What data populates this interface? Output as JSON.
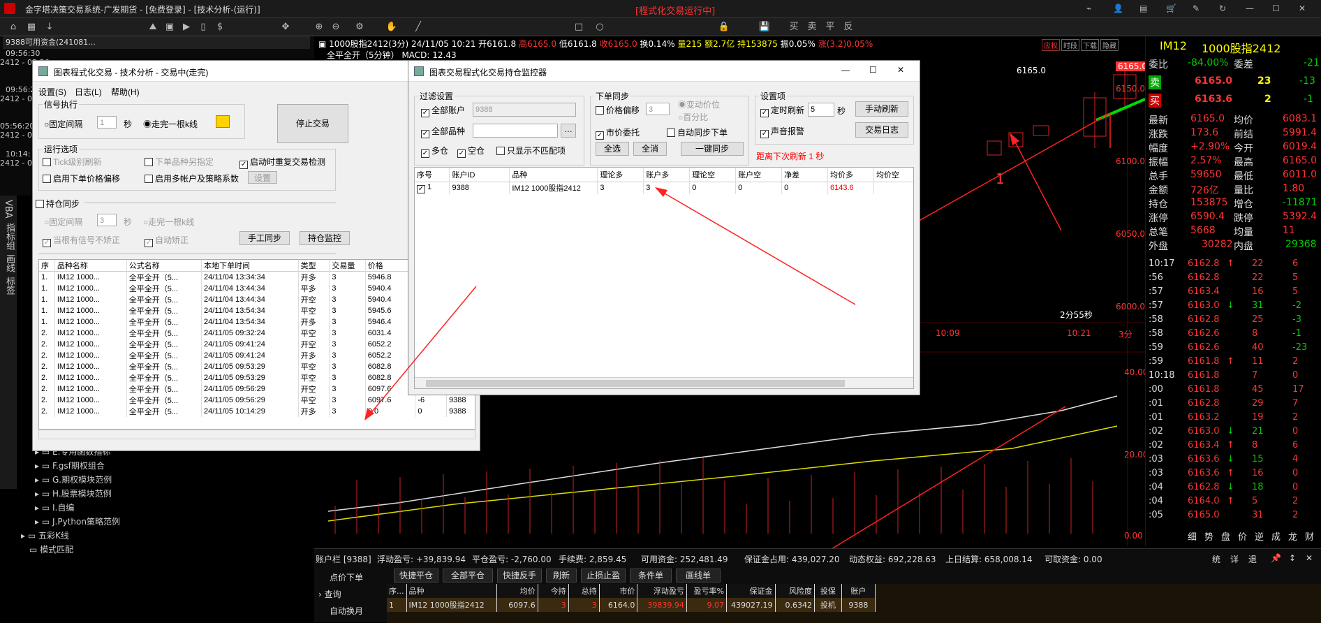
{
  "app": {
    "title": "金字塔决策交易系统-广发期货 - [免费登录] - [技术分析-(运行)]",
    "running": "[程式化交易运行中]"
  },
  "sidebar_top": {
    "line1": "9388可用资金(241081...",
    "times": [
      "09:56:30",
      "2412 - 05:56",
      "09:56:20",
      "2412 - 05:56",
      "05:56:20",
      "2412 - 05:56",
      "10:14:",
      "2412 - 05:"
    ]
  },
  "left_tabs": [
    "VBA",
    "指标组",
    "画线",
    "标签"
  ],
  "tree": {
    "items": [
      "E.专用函数指标",
      "F.gsf期权组合",
      "G.期权模块范例",
      "H.股票模块范例",
      "I.自编",
      "J.Python策略范例"
    ],
    "sub": [
      "五彩K线",
      "模式匹配"
    ]
  },
  "chart_header": {
    "symbol": "1000股指2412(3分) 24/11/05 10:21",
    "open": "开6161.8",
    "high": "高6165.0",
    "low": "低6161.8",
    "close": "收6165.0",
    "chg": "换0.14%",
    "vol": "量215",
    "amt": "额2.7亿",
    "oi": "持153875",
    "amp": "振0.05%",
    "rise": "涨(3.2)0.05%",
    "macd": "全平全开（5分钟） MACD: 12.43",
    "tabs": [
      "应权",
      "时段",
      "下载",
      "隐藏"
    ]
  },
  "chart_labels": {
    "price_tag": "6165.0",
    "yaxis": [
      "6150.0",
      "6100.0",
      "6050.0",
      "6000.0"
    ],
    "hi_lbl": "6165.0",
    "timer": "2分55秒",
    "xaxis": [
      "10:09",
      "10:21",
      "3分"
    ],
    "macd_axis": [
      "40.00",
      "20.00",
      "0.00"
    ],
    "annot1": "1",
    "annot2": "2"
  },
  "exec_window": {
    "title": "图表程式化交易 - 技术分析 - 交易中(走完)",
    "menu": [
      "设置(S)",
      "日志(L)",
      "帮助(H)"
    ],
    "signal": "信号执行",
    "fixed": "固定间隔",
    "fixed_val": "1",
    "sec": "秒",
    "walk": "走完一根k线",
    "stop": "停止交易",
    "run_opts": "运行选项",
    "tick": "Tick级别刷新",
    "next": "下单品种另指定",
    "restart": "启动时重复交易检测",
    "price_off": "启用下单价格偏移",
    "multi": "启用多帐户及策略系数",
    "setup": "设置",
    "sync": "持仓同步",
    "fixed2": "固定间隔",
    "fixed2_val": "3",
    "sec2": "秒",
    "walk2": "走完一根k线",
    "nosig": "当根有信号不矫正",
    "auto": "自动矫正",
    "manual": "手工同步",
    "monitor": "持仓监控",
    "cols": [
      "序",
      "品种名称",
      "公式名称",
      "本地下单时间",
      "类型",
      "交易量",
      "价格",
      "滑点"
    ],
    "rows": [
      [
        "1.",
        "IM12 1000...",
        "全平全开（5...",
        "24/11/04 13:34:34",
        "开多",
        "3",
        "5946.8",
        "0",
        ""
      ],
      [
        "1.",
        "IM12 1000...",
        "全平全开（5...",
        "24/11/04 13:44:34",
        "平多",
        "3",
        "5940.4",
        "3",
        ""
      ],
      [
        "1.",
        "IM12 1000...",
        "全平全开（5...",
        "24/11/04 13:44:34",
        "开空",
        "3",
        "5940.4",
        "3",
        ""
      ],
      [
        "1.",
        "IM12 1000...",
        "全平全开（5...",
        "24/11/04 13:54:34",
        "平空",
        "3",
        "5945.6",
        "1",
        ""
      ],
      [
        "1.",
        "IM12 1000...",
        "全平全开（5...",
        "24/11/04 13:54:34",
        "开多",
        "3",
        "5946.4",
        "5",
        ""
      ],
      [
        "2.",
        "IM12 1000...",
        "全平全开（5...",
        "24/11/05 09:32:24",
        "平空",
        "3",
        "6031.4",
        "2",
        ""
      ],
      [
        "2.",
        "IM12 1000...",
        "全平全开（5...",
        "24/11/05 09:41:24",
        "开空",
        "3",
        "6052.2",
        "1",
        ""
      ],
      [
        "2.",
        "IM12 1000...",
        "全平全开（5...",
        "24/11/05 09:41:24",
        "开多",
        "3",
        "6052.2",
        "1",
        ""
      ],
      [
        "2.",
        "IM12 1000...",
        "全平全开（5...",
        "24/11/05 09:53:29",
        "平空",
        "3",
        "6082.8",
        "6",
        ""
      ],
      [
        "2.",
        "IM12 1000...",
        "全平全开（5...",
        "24/11/05 09:53:29",
        "平空",
        "3",
        "6082.8",
        "",
        ""
      ],
      [
        "2.",
        "IM12 1000...",
        "全平全开（5...",
        "24/11/05 09:56:29",
        "开空",
        "3",
        "6097.6",
        "-6",
        "9388"
      ],
      [
        "2.",
        "IM12 1000...",
        "全平全开（5...",
        "24/11/05 09:56:29",
        "平空",
        "3",
        "6097.6",
        "-6",
        "9388"
      ],
      [
        "2.",
        "IM12 1000...",
        "全平全开（5...",
        "24/11/05 10:14:29",
        "开多",
        "3",
        "0.0",
        "0",
        "9388"
      ]
    ]
  },
  "monitor_window": {
    "title": "图表交易程式化交易持仓监控器",
    "filter": "过滤设置",
    "all_acct": "全部账户",
    "acct_val": "9388",
    "all_sym": "全部品种",
    "long": "多仓",
    "short": "空仓",
    "mismatch": "只显示不匹配项",
    "order_sync": "下单同步",
    "price_off": "价格偏移",
    "price_off_val": "3",
    "var_price": "变动价位",
    "pct": "百分比",
    "market": "市价委托",
    "auto_sync": "自动同步下单",
    "selall": "全选",
    "clear": "全消",
    "onekey": "一键同步",
    "settings": "设置项",
    "timed": "定时刷新",
    "timed_val": "5",
    "sec": "秒",
    "manual_ref": "手动刷新",
    "sound": "声音报警",
    "log": "交易日志",
    "next": "距离下次刷新 1 秒",
    "cols": [
      "序号",
      "账户ID",
      "品种",
      "理论多",
      "账户多",
      "理论空",
      "账户空",
      "净差",
      "均价多",
      "均价空"
    ],
    "row": [
      "1",
      "9388",
      "IM12 1000股指2412",
      "3",
      "3",
      "0",
      "0",
      "0",
      "6143.6",
      ""
    ]
  },
  "right_panel": {
    "symbol": "IM12",
    "name": "1000股指2412",
    "weibi": [
      "委比",
      "-84.00%",
      "委差",
      "-21"
    ],
    "sell": [
      "卖",
      "6165.0",
      "23",
      "-13"
    ],
    "buy": [
      "买",
      "6163.6",
      "2",
      "-1"
    ],
    "stats": [
      [
        "最新",
        "6165.0",
        "均价",
        "6083.1"
      ],
      [
        "涨跌",
        "173.6",
        "前结",
        "5991.4"
      ],
      [
        "幅度",
        "+2.90%",
        "今开",
        "6019.4"
      ],
      [
        "振幅",
        "2.57%",
        "最高",
        "6165.0"
      ],
      [
        "总手",
        "59650",
        "最低",
        "6011.0"
      ],
      [
        "金额",
        "726亿",
        "量比",
        "1.80"
      ],
      [
        "持仓",
        "153875",
        "增仓",
        "-11871"
      ],
      [
        "涨停",
        "6590.4",
        "跌停",
        "5392.4"
      ],
      [
        "总笔",
        "5668",
        "均量",
        "11"
      ]
    ],
    "outer": [
      "外盘",
      "30282",
      "内盘",
      "29368"
    ],
    "ticks": [
      [
        "10:17",
        "6162.8",
        "↑",
        "22",
        "6"
      ],
      [
        ":56",
        "6162.8",
        "",
        "22",
        "5"
      ],
      [
        ":57",
        "6163.4",
        "",
        "16",
        "5"
      ],
      [
        ":57",
        "6163.0",
        "↓",
        "31",
        "-2"
      ],
      [
        ":58",
        "6162.8",
        "",
        "25",
        "-3"
      ],
      [
        ":58",
        "6162.6",
        "",
        "8",
        "-1"
      ],
      [
        ":59",
        "6162.6",
        "",
        "40",
        "-23"
      ],
      [
        ":59",
        "6161.8",
        "↑",
        "11",
        "2"
      ],
      [
        "10:18",
        "6161.8",
        "",
        "7",
        "0"
      ],
      [
        ":00",
        "6161.8",
        "",
        "45",
        "17"
      ],
      [
        ":01",
        "6162.8",
        "",
        "29",
        "7"
      ],
      [
        ":01",
        "6163.2",
        "",
        "19",
        "2"
      ],
      [
        ":02",
        "6163.0",
        "↓",
        "21",
        "0"
      ],
      [
        ":02",
        "6163.4",
        "↑",
        "8",
        "6"
      ],
      [
        ":03",
        "6163.6",
        "↓",
        "15",
        "4"
      ],
      [
        ":03",
        "6163.6",
        "↑",
        "16",
        "0"
      ],
      [
        ":04",
        "6162.8",
        "↓",
        "18",
        "0"
      ],
      [
        ":04",
        "6164.0",
        "↑",
        "5",
        "2"
      ],
      [
        ":05",
        "6165.0",
        "",
        "31",
        "2"
      ]
    ],
    "tabs": [
      "细",
      "势",
      "盘",
      "价",
      "逆",
      "成",
      "龙",
      "财"
    ]
  },
  "account": {
    "bar": "账户栏 [9388]",
    "float": "浮动盈亏: +39,839.94",
    "close": "平仓盈亏: -2,760.00",
    "fee": "手续费: 2,859.45",
    "avail": "可用资金: 252,481.49",
    "margin": "保证金占用: 439,027.20",
    "equity": "动态权益: 692,228.63",
    "settle": "上日结算: 658,008.14",
    "withdraw": "可取资金: 0.00",
    "right": [
      "统",
      "详",
      "退"
    ],
    "side": [
      "点价下单",
      "查询",
      "自动换月"
    ],
    "buttons": [
      "快捷平仓",
      "全部平仓",
      "快捷反手",
      "刷新",
      "止损止盈",
      "条件单",
      "画线单"
    ],
    "cols": [
      "序...",
      "品种",
      "均价",
      "今持",
      "总持",
      "市价",
      "浮动盈亏",
      "盈亏率%",
      "保证金",
      "风险度",
      "投保",
      "账户"
    ],
    "row": [
      "1",
      "IM12 1000股指2412",
      "6097.6",
      "3",
      "3",
      "6164.0",
      "39839.94",
      "9.07",
      "439027.19",
      "0.6342",
      "投机",
      "9388"
    ]
  }
}
